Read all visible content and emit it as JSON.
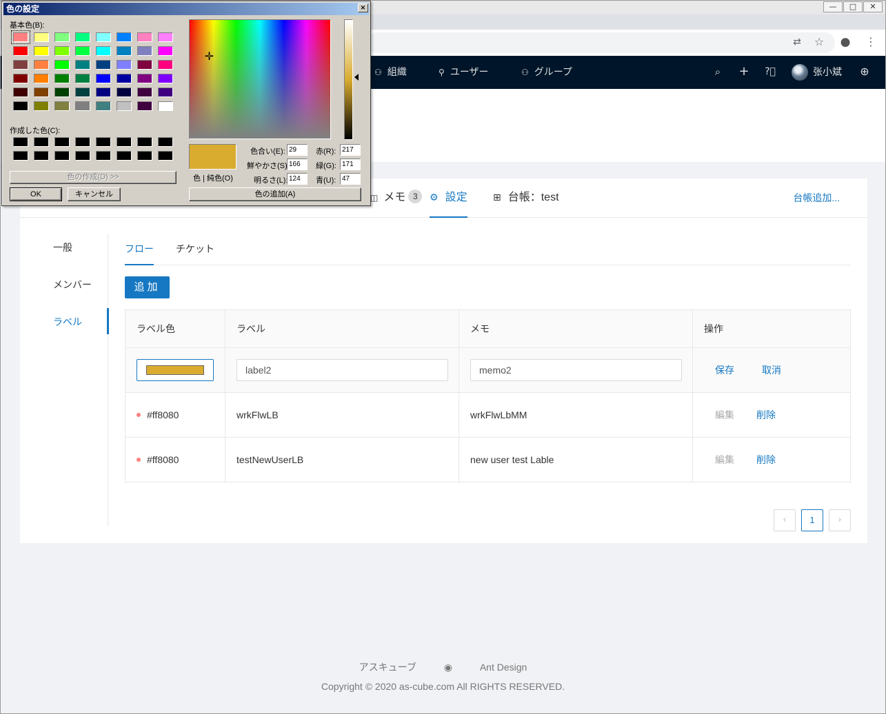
{
  "window": {
    "min": "—",
    "restore": "□",
    "close": "✕"
  },
  "omnibox": {
    "translate_icon": "translate-icon",
    "star_icon": "star-icon",
    "account_icon": "account-icon",
    "menu_icon": "menu-icon"
  },
  "header": {
    "nav": [
      {
        "label": "組織",
        "icon": "team-icon"
      },
      {
        "label": "ユーザー",
        "icon": "user-icon"
      },
      {
        "label": "グループ",
        "icon": "team-icon"
      }
    ],
    "username": "张小斌"
  },
  "tabs": [
    {
      "label": "メモ",
      "badge": "3",
      "icon": "memo-icon"
    },
    {
      "label": "設定",
      "icon": "setting-icon"
    },
    {
      "label": "台帳：test",
      "icon": "table-icon"
    }
  ],
  "add_ledger": "台帳追加...",
  "side_menu": [
    "一般",
    "メンバー",
    "ラベル"
  ],
  "sub_tabs": [
    "フロー",
    "チケット"
  ],
  "add_button": "追加",
  "table": {
    "headers": [
      "ラベル色",
      "ラベル",
      "メモ",
      "操作"
    ],
    "editing": {
      "color": "#d9ab2f",
      "label": "label2",
      "memo": "memo2",
      "save": "保存",
      "cancel": "取消"
    },
    "rows": [
      {
        "color_text": "#ff8080",
        "color": "#ff8080",
        "label": "wrkFlwLB",
        "memo": "wrkFlwLbMM",
        "edit": "編集",
        "delete": "削除"
      },
      {
        "color_text": "#ff8080",
        "color": "#ff8080",
        "label": "testNewUserLB",
        "memo": "new user test Lable",
        "edit": "編集",
        "delete": "削除"
      }
    ]
  },
  "pagination": {
    "current": "1",
    "prev": "‹",
    "next": "›"
  },
  "footer": {
    "links": [
      "アスキューブ",
      "github-icon",
      "Ant Design"
    ],
    "copyright": "Copyright © 2020 as-cube.com All RIGHTS RESERVED."
  },
  "dialog": {
    "title": "色の設定",
    "basic_colors_label": "基本色(B):",
    "custom_colors_label": "作成した色(C):",
    "basic_colors": [
      "#ff8080",
      "#ffff80",
      "#80ff80",
      "#00ff80",
      "#80ffff",
      "#0080ff",
      "#ff80c0",
      "#ff80ff",
      "#ff0000",
      "#ffff00",
      "#80ff00",
      "#00ff40",
      "#00ffff",
      "#0080c0",
      "#8080c0",
      "#ff00ff",
      "#804040",
      "#ff8040",
      "#00ff00",
      "#008080",
      "#004080",
      "#8080ff",
      "#800040",
      "#ff0080",
      "#800000",
      "#ff8000",
      "#008000",
      "#008040",
      "#0000ff",
      "#0000a0",
      "#800080",
      "#8000ff",
      "#400000",
      "#804000",
      "#004000",
      "#004040",
      "#000080",
      "#000040",
      "#400040",
      "#400080",
      "#000000",
      "#808000",
      "#808040",
      "#808080",
      "#408080",
      "#c0c0c0",
      "#400040",
      "#ffffff"
    ],
    "custom_colors": [
      "#000000",
      "#000000",
      "#000000",
      "#000000",
      "#000000",
      "#000000",
      "#000000",
      "#000000",
      "#000000",
      "#000000",
      "#000000",
      "#000000",
      "#000000",
      "#000000",
      "#000000",
      "#000000"
    ],
    "define_button": "色の作成(D) >>",
    "ok": "OK",
    "cancel": "キャンセル",
    "color_solid_label": "色 | 純色(O)",
    "hue_label": "色合い(E):",
    "hue": "29",
    "sat_label": "鮮やかさ(S):",
    "sat": "166",
    "lum_label": "明るさ(L):",
    "lum": "124",
    "red_label": "赤(R):",
    "red": "217",
    "green_label": "緑(G):",
    "green": "171",
    "blue_label": "青(U):",
    "blue": "47",
    "add_button": "色の追加(A)",
    "selected_color": "#d9ab2f"
  }
}
